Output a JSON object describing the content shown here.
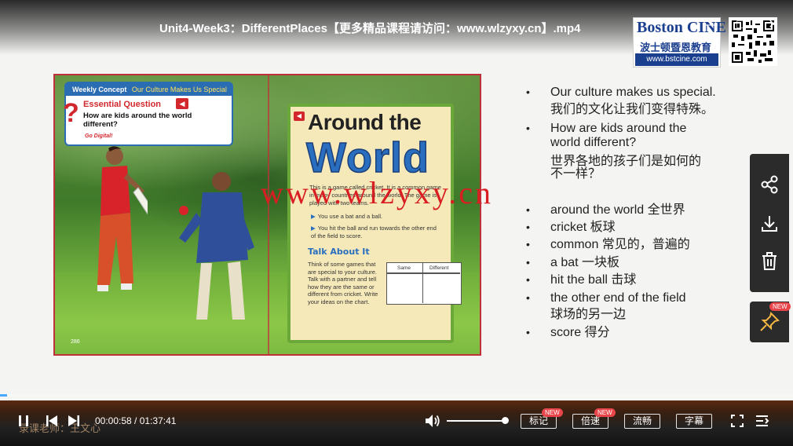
{
  "player": {
    "title": "Unit4-Week3：DifferentPlaces【更多精品课程请访问：www.wlzyxy.cn】.mp4",
    "window_controls": {
      "minimize": "—",
      "maximize": "□",
      "close": "✕"
    },
    "time_current": "00:00:58",
    "time_total": "01:37:41",
    "time_sep": " / ",
    "progress_fraction": 0.006,
    "volume_fraction": 1.0,
    "buttons": {
      "mark": "标记",
      "speed": "倍速",
      "smooth": "流畅",
      "subtitle": "字幕"
    },
    "new_badge": "NEW",
    "watermark_teacher": "录课老师：王文心"
  },
  "logo": {
    "brand": "Boston CINE",
    "cn": "波士顿暨恩教育",
    "url": "www.bstcine.com"
  },
  "slide": {
    "book": {
      "weekly_concept": "Weekly Concept",
      "concept_title": "Our Culture Makes Us Special",
      "essential_q_label": "Essential Question",
      "essential_q": "How are kids around the world different?",
      "go_digital": "Go Digital!",
      "heading1": "Around the",
      "heading2": "World",
      "body": "This is a game called cricket. It is a common game in many countries around the world. The game is played with two teams.",
      "bullet1": "You use a bat and a ball.",
      "bullet2": "You hit the ball and run towards the other end of the field to score.",
      "talk_about_it": "Talk About It",
      "talk_text": "Think of some games that are special to your culture. Talk with a partner and tell how they are the same or different from cricket. Write your ideas on the chart.",
      "chart_col1": "Same",
      "chart_col2": "Different",
      "page_no": "286"
    },
    "overlay_watermark": "www.wlzyxy.cn",
    "notes": [
      {
        "en": "Our culture makes us special.",
        "cn": "我们的文化让我们变得特殊。"
      },
      {
        "en": "How are kids around the",
        "en2": "world different?",
        "cn": "世界各地的孩子们是如何的",
        "cn2": "不一样？"
      },
      {
        "text": "around the world 全世界"
      },
      {
        "text": "cricket 板球"
      },
      {
        "text": "common 常见的，普遍的"
      },
      {
        "text": "a bat 一块板"
      },
      {
        "text": "hit the ball 击球"
      },
      {
        "text": "the other end of the field"
      },
      {
        "text": "球场的另一边"
      },
      {
        "text": "score 得分"
      }
    ],
    "bullet": "•"
  },
  "colors": {
    "accent_blue": "#49a8ff",
    "badge_red": "#e8454a",
    "watermark_red": "#d81e22"
  },
  "icons": [
    "share-icon",
    "download-icon",
    "delete-icon",
    "pin-icon",
    "play-pause-icon",
    "prev-icon",
    "next-icon",
    "volume-icon",
    "fullscreen-icon",
    "playlist-icon",
    "qr-code"
  ]
}
